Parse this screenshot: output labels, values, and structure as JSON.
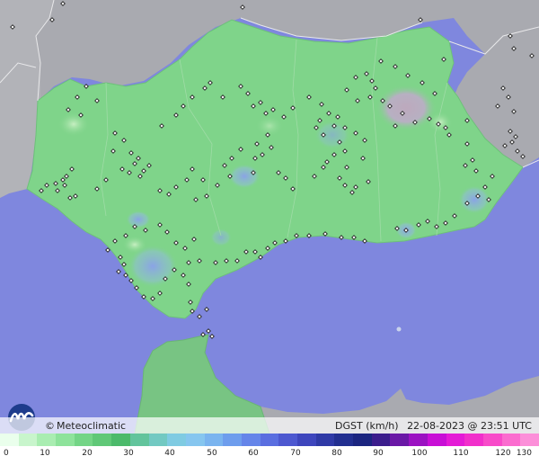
{
  "map": {
    "colors": {
      "sea": "#7f87de",
      "land_out": "#a9aab0",
      "andalucia": "#7fd48a",
      "morocco": "#78c483",
      "station": "#222222"
    },
    "relief_patches": [
      {
        "id": "gust-sierra-nevada-high",
        "color": "#c7b6c6"
      },
      {
        "id": "gust-cadiz-strait",
        "color": "#8ca8e4"
      },
      {
        "id": "gust-almeria-coast",
        "color": "#8ab4e0"
      }
    ]
  },
  "brand": {
    "copyright": "©",
    "name": "Meteoclimatic"
  },
  "meta": {
    "variable": "DGST (km/h)",
    "timestamp": "22-08-2023 @ 23:51 UTC"
  },
  "legend": {
    "ticks": [
      "0",
      "10",
      "20",
      "30",
      "40",
      "50",
      "60",
      "70",
      "80",
      "90",
      "100",
      "110",
      "120",
      "130"
    ],
    "colors": [
      "#eaffec",
      "#c8f5cc",
      "#a9edb1",
      "#8ee39b",
      "#74d586",
      "#60c877",
      "#4cba6b",
      "#62c49c",
      "#72c9c2",
      "#7fcbe2",
      "#86c6ef",
      "#7ab4ef",
      "#6e9ded",
      "#6585e9",
      "#5a6ee0",
      "#4d58d0",
      "#3e46bd",
      "#2f3aa6",
      "#222f90",
      "#1b2580",
      "#3b1d8c",
      "#6a18a6",
      "#9b12c2",
      "#c80fd6",
      "#e41bd6",
      "#f12fcb",
      "#f84bc9",
      "#fb6ccf",
      "#fc8fd9"
    ]
  }
}
